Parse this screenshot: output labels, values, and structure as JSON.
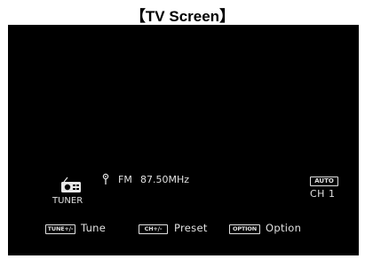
{
  "caption": "【TV Screen】",
  "source": {
    "icon": "radio-icon",
    "label": "TUNER"
  },
  "reception": {
    "icon": "antenna-icon",
    "band": "FM",
    "frequency": "87.50MHz"
  },
  "mode_badge": "AUTO",
  "channel": "CH 1",
  "controls": [
    {
      "key": "TUNE+/-",
      "label": "Tune"
    },
    {
      "key": "CH+/-",
      "label": "Preset"
    },
    {
      "key": "OPTION",
      "label": "Option"
    }
  ],
  "colors": {
    "screen_bg": "#000000",
    "text": "#e0e0e0"
  }
}
